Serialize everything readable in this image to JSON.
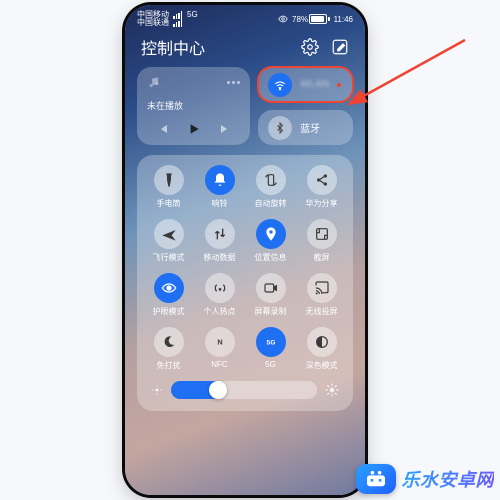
{
  "status": {
    "carrier1": "中国移动",
    "carrier2": "中国联通",
    "net": "5G",
    "battery_pct": "78%",
    "time": "11:46"
  },
  "header": {
    "title": "控制中心"
  },
  "media": {
    "state": "未在播放"
  },
  "wifi": {
    "label": "WLAN"
  },
  "bluetooth": {
    "label": "蓝牙"
  },
  "tiles": [
    {
      "key": "flashlight",
      "label": "手电筒",
      "on": false
    },
    {
      "key": "ring",
      "label": "响铃",
      "on": true
    },
    {
      "key": "autorotate",
      "label": "自动旋转",
      "on": false
    },
    {
      "key": "share",
      "label": "华为分享",
      "on": false
    },
    {
      "key": "airplane",
      "label": "飞行模式",
      "on": false
    },
    {
      "key": "data",
      "label": "移动数据",
      "on": false
    },
    {
      "key": "location",
      "label": "位置信息",
      "on": true
    },
    {
      "key": "screenshot",
      "label": "截屏",
      "on": false
    },
    {
      "key": "eyecare",
      "label": "护眼模式",
      "on": true
    },
    {
      "key": "hotspot",
      "label": "个人热点",
      "on": false
    },
    {
      "key": "record",
      "label": "屏幕录制",
      "on": false
    },
    {
      "key": "cast",
      "label": "无线投屏",
      "on": false
    },
    {
      "key": "dnd",
      "label": "免打扰",
      "on": false
    },
    {
      "key": "nfc",
      "label": "NFC",
      "on": false
    },
    {
      "key": "fiveg",
      "label": "5G",
      "on": true
    },
    {
      "key": "dark",
      "label": "深色模式",
      "on": false
    }
  ],
  "watermark": {
    "text": "乐水安卓网"
  },
  "colors": {
    "accent": "#1e6ff2",
    "highlight": "#e43"
  }
}
